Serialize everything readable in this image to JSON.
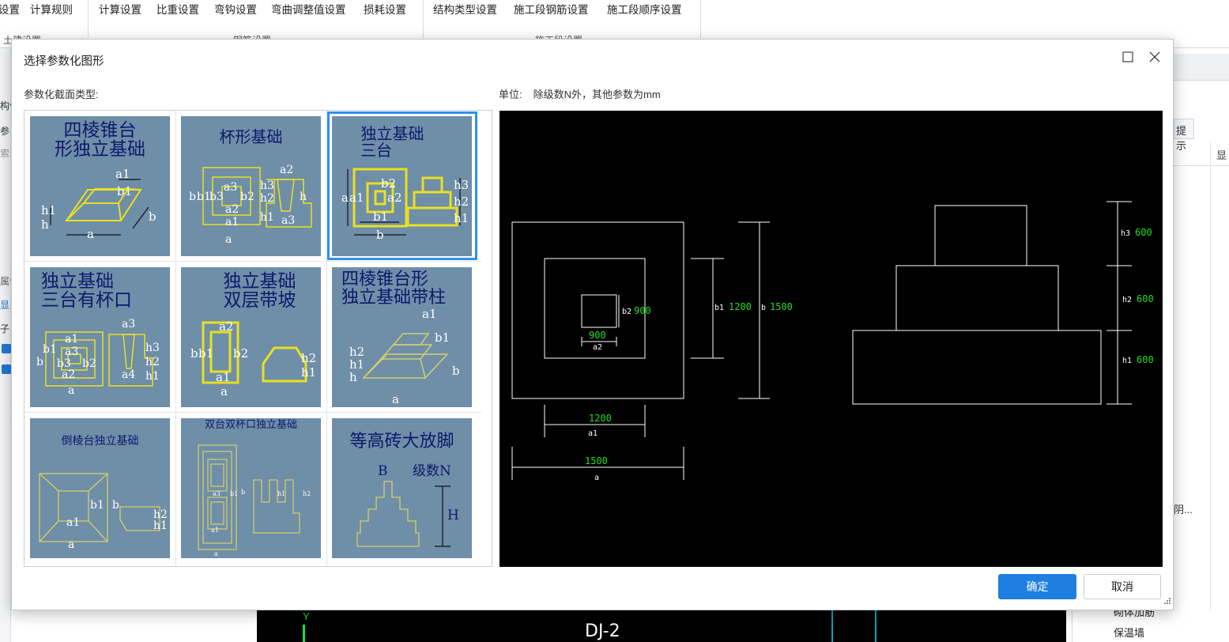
{
  "app": {
    "ribbon_items": [
      "设置",
      "计算规则",
      "计算设置",
      "比重设置",
      "弯钩设置",
      "弯曲调整值设置",
      "损耗设置",
      "结构类型设置",
      "施工段钢筋设置",
      "施工段顺序设置"
    ],
    "ribbon_groups": [
      "土建设置",
      "钢筋设置",
      "施工段设置"
    ],
    "left_panel_texts": [
      "构件",
      "参",
      "索",
      "属性",
      "显",
      "子"
    ],
    "right_panel": {
      "tab": "提示",
      "col_head": "显",
      "row_item": "阴..."
    },
    "bottom_rows": [
      "砌体加筋",
      "保温墙"
    ],
    "canvas": {
      "axis_label": "Y",
      "drawing_label": "DJ-2"
    }
  },
  "dialog": {
    "title": "选择参数化图形",
    "section_type_label": "参数化截面类型:",
    "unit_label": "单位:",
    "unit_value": "除级数N外，其他参数为mm",
    "confirm_button": "确定",
    "cancel_button": "取消",
    "tiles": [
      {
        "title_line1": "四棱锥台",
        "title_line2": "形独立基础",
        "selected": false
      },
      {
        "title_line1": "杯形基础",
        "title_line2": "",
        "selected": false
      },
      {
        "title_line1": "独立基础",
        "title_line2": "三台",
        "selected": true
      },
      {
        "title_line1": "独立基础",
        "title_line2": "三台有杯口",
        "selected": false
      },
      {
        "title_line1": "独立基础",
        "title_line2": "双层带坡",
        "selected": false
      },
      {
        "title_line1": "四棱锥台形",
        "title_line2": "独立基础带柱",
        "selected": false
      },
      {
        "title_line1": "倒棱台独立基础",
        "title_line2": "",
        "selected": false
      },
      {
        "title_line1": "双台双杯口独立基础",
        "title_line2": "",
        "selected": false
      },
      {
        "title_line1": "等高砖大放脚",
        "title_line2": "",
        "selected": false
      }
    ],
    "tile_labels": {
      "t1": [
        "a1",
        "b1",
        "h1",
        "h",
        "a",
        "b"
      ],
      "t2": [
        "a2",
        "b",
        "b1",
        "b3",
        "a3",
        "b2",
        "a2",
        "a1",
        "a",
        "h3",
        "h2",
        "h1",
        "h",
        "a3"
      ],
      "t3": [
        "b2",
        "a",
        "a1",
        "a2",
        "b1",
        "b",
        "h3",
        "h2",
        "h1"
      ],
      "t4": [
        "a3",
        "a1",
        "b1",
        "a3",
        "b",
        "b3",
        "b2",
        "a2",
        "a",
        "a4",
        "h3",
        "h2",
        "h1"
      ],
      "t5": [
        "a2",
        "b",
        "b1",
        "b2",
        "a1",
        "a",
        "h2",
        "h1"
      ],
      "t6": [
        "a1",
        "b1",
        "h2",
        "h1",
        "h",
        "b",
        "a"
      ],
      "t7": [
        "b1",
        "b",
        "a1",
        "a",
        "h2",
        "h1"
      ],
      "t8": [
        "a3",
        "b1",
        "b",
        "h1",
        "h2",
        "a1",
        "a"
      ],
      "t9": [
        "B",
        "级数N",
        "H"
      ]
    },
    "preview": {
      "plan": {
        "b2_label": "b2",
        "b2_value": "900",
        "a2_value": "900",
        "a2_label": "a2",
        "b1_label": "b1",
        "b1_value": "1200",
        "b_label": "b",
        "b_value": "1500",
        "a1_value": "1200",
        "a1_label": "a1",
        "a_value": "1500",
        "a_label": "a"
      },
      "elevation": {
        "h3_label": "h3",
        "h3_value": "600",
        "h2_label": "h2",
        "h2_value": "600",
        "h1_label": "h1",
        "h1_value": "600"
      },
      "colors": {
        "dimension_value": "#22dd22",
        "line": "#ffffff",
        "background": "#000000"
      }
    }
  }
}
